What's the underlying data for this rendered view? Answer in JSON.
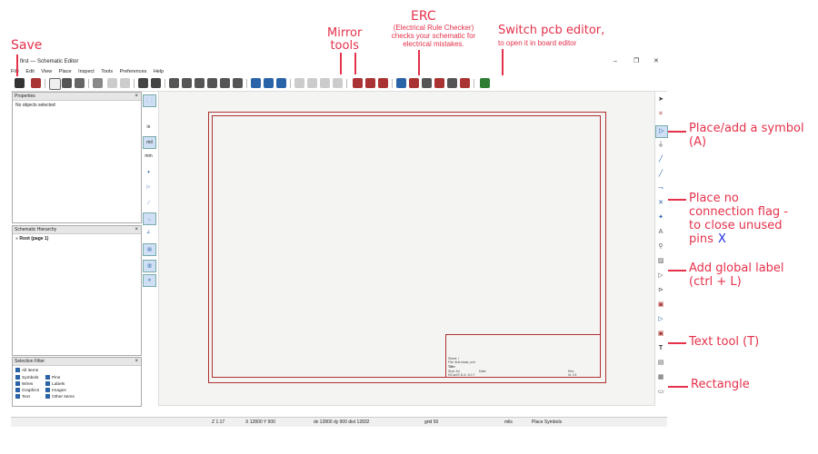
{
  "window": {
    "title": "first — Schematic Editor",
    "controls": [
      "–",
      "❐",
      "✕"
    ]
  },
  "menu": [
    "File",
    "Edit",
    "View",
    "Place",
    "Inspect",
    "Tools",
    "Preferences",
    "Help"
  ],
  "panels": {
    "properties": {
      "title": "Properties",
      "empty_text": "No objects selected"
    },
    "hierarchy": {
      "title": "Schematic Hierarchy",
      "root": "Root (page 1)"
    },
    "selection_filter": {
      "title": "Selection Filter",
      "items": [
        "All items",
        "Symbols",
        "Pins",
        "Wires",
        "Labels",
        "Graphics",
        "Images",
        "Text",
        "Other items"
      ]
    }
  },
  "left_tools": [
    "in",
    "mil",
    "mm"
  ],
  "title_block": {
    "sheet": "Sheet: /",
    "file": "File: first.kicad_sch",
    "title": "Title:",
    "size": "Size: A4",
    "date": "Date:",
    "rev": "Rev:",
    "kicad": "KiCad E.D.A. 6.0.7",
    "id": "Id: 1/1"
  },
  "status": {
    "zoom": "Z 1.17",
    "xy": "X 12800  Y 900",
    "dxdy": "dx 12800  dy 900  dist 12832",
    "grid": "grid 50",
    "units": "mils",
    "mode": "Place Symbols"
  },
  "annotations": {
    "save": "Save",
    "mirror": "Mirror\ntools",
    "erc_title": "ERC",
    "erc_desc": "(Electrical Rule Checker)\nchecks your schematic for\nelectrical mistakes.",
    "pcb_title": "Switch pcb editor,",
    "pcb_desc": "to open it in board editor",
    "place_symbol": "Place/add a symbol\n(A)",
    "no_connect": "Place no\nconnection flag -\nto close unused\npins",
    "no_connect_key": "X",
    "global_label": "Add global label\n(ctrl + L)",
    "text_tool": "Text tool (T)",
    "rectangle": "Rectangle"
  },
  "colors": {
    "accent": "#e5314a",
    "sheet": "#b13232",
    "icon": "#2a63a8"
  }
}
